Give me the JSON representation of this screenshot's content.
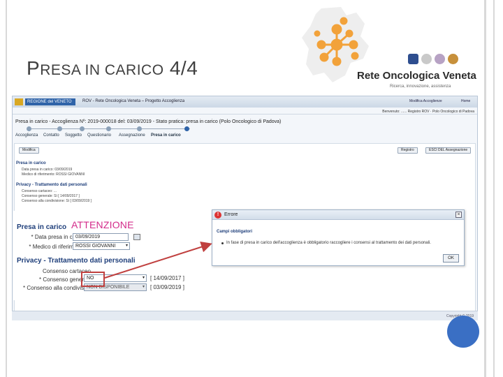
{
  "slide": {
    "title_first": "P",
    "title_mid": "RESA IN CARICO",
    "title_num": "4/4",
    "attention": "ATTENZIONE"
  },
  "logo": {
    "name": "Rete Oncologica Veneta",
    "tagline": "Ricerca, innovazione, assistenza"
  },
  "app": {
    "region": "REGIONE del VENETO",
    "title": "ROV - Rete Oncologica Veneta – Progetto Accoglienza",
    "header_buttons": [
      "Modifica Accoglienze",
      "Home"
    ],
    "user_info": "Benvenuto: ......  Registro ROV · Polo Oncologico di Padova",
    "practice": "Presa in carico - Accoglienza Nº: 2019-000018 del: 03/09/2019 - Stato pratica: presa in carico (Polo Oncologico di Padova)",
    "steps": [
      "Accoglienza",
      "Contatto",
      "Soggetto",
      "Questionario",
      "Assegnazione",
      "Presa in carico"
    ],
    "modify_button": "Modifica",
    "right_buttons": [
      "Registro",
      "ESCI DEL  Assegnazione"
    ],
    "small_presa_title": "Presa in carico",
    "small_presa_rows": [
      "Data presa in carico: 03/09/2019",
      "Medico di riferimento: ROSSI GIOVANNI"
    ],
    "small_privacy_title": "Privacy - Trattamento dati personali",
    "small_privacy_rows": [
      "Consenso cartaceo: ...",
      "Consenso generale: Sì  [ 14/09/2017 ]",
      "Consenso alla condivisione: Sì  [ 03/09/2019 ]"
    ],
    "copyright": "Copyright © 2019"
  },
  "form": {
    "presa_title": "Presa in carico",
    "data_label": "* Data presa in carico",
    "data_value": "03/09/2019",
    "medico_label": "* Medico di riferimento",
    "medico_value": "ROSSI GIOVANNI",
    "privacy_title": "Privacy - Trattamento dati personali",
    "cartaceo_label": "Consenso cartaceo",
    "generale_label": "* Consenso generale",
    "generale_value": "NO",
    "generale_date": "[  14/09/2017  ]",
    "condivisione_label": "* Consenso alla condivisione",
    "condivisione_value": "NON DISPONIBILE",
    "condivisione_date": "[  03/09/2019  ]"
  },
  "dialog": {
    "title": "Errore",
    "heading": "Campi obbligatori",
    "message": "In fase di presa in carico dell'accoglienza è obbligatorio raccogliere i consensi al trattamento dei dati personali.",
    "ok": "OK"
  },
  "colors": {
    "accent_blue": "#1e3e7a",
    "attention_pink": "#d32b8a",
    "highlight_red": "#c0403f",
    "logo_orange": "#f2a23a"
  }
}
